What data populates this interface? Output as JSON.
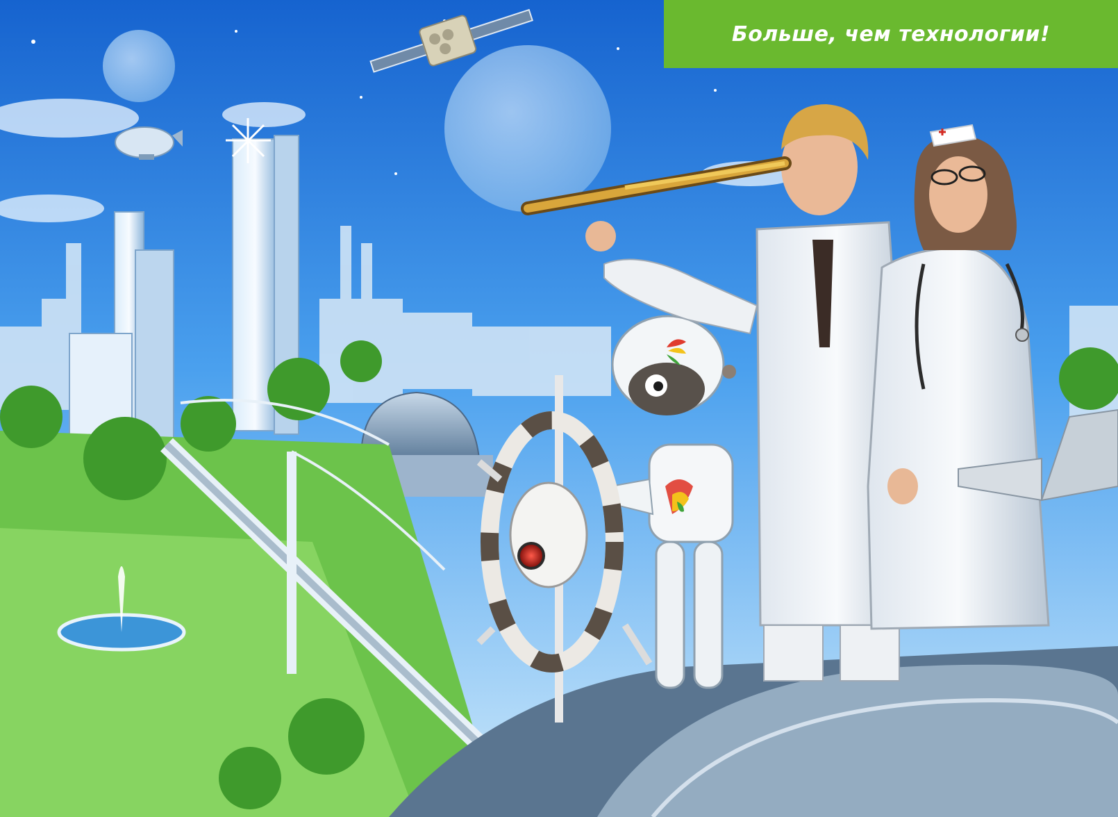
{
  "banner": {
    "text": "Больше, чем технологии!",
    "background": "#6ab92f",
    "text_color": "#ffffff"
  },
  "scene": {
    "sky_top": "#1a6fd4",
    "sky_bottom": "#bfe4fb",
    "accent_green": "#3f9a2c"
  }
}
